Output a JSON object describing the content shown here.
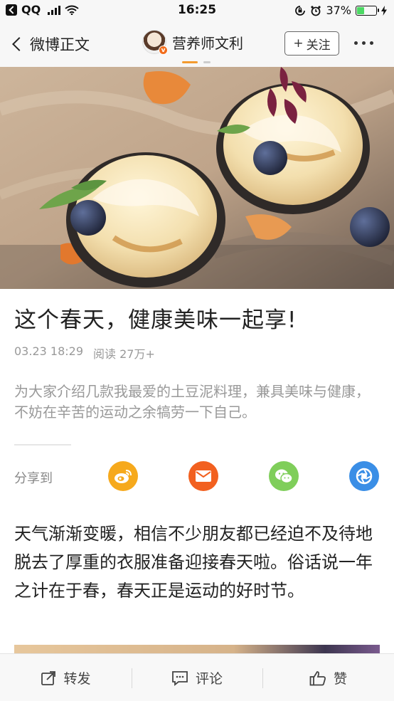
{
  "status_bar": {
    "app": "QQ",
    "time": "16:25",
    "battery": "37%",
    "battery_level": 0.37
  },
  "nav": {
    "back_label": "微博正文",
    "author_name": "营养师文利",
    "follow_plus": "+",
    "follow_label": "关注"
  },
  "article": {
    "title": "这个春天，健康美味一起享!",
    "date": "03.23 18:29",
    "reads": "阅读 27万+",
    "summary": "为大家介绍几款我最爱的土豆泥料理，兼具美味与健康，不妨在辛苦的运动之余犒劳一下自己。",
    "share_label": "分享到",
    "body": "天气渐渐变暖，相信不少朋友都已经迫不及待地脱去了厚重的衣服准备迎接春天啦。俗话说一年之计在于春，春天正是运动的好时节。"
  },
  "bottom_bar": {
    "repost": "转发",
    "comment": "评论",
    "like": "赞"
  },
  "colors": {
    "weibo_share": "#f6a91c",
    "mail_share": "#f2601f",
    "wechat_share": "#7fce5a",
    "moments_share": "#3a8ee6",
    "indicator": "#f39b2f"
  }
}
